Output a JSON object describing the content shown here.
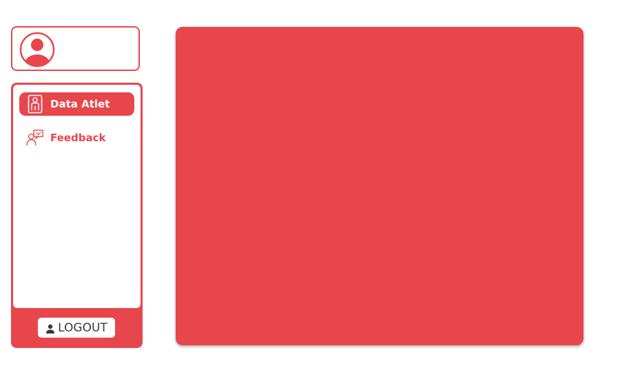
{
  "profile": {
    "avatar_icon": "user-circle-icon"
  },
  "sidebar": {
    "items": [
      {
        "label": "Data Atlet",
        "icon": "athlete-card-icon",
        "active": true
      },
      {
        "label": "Feedback",
        "icon": "user-feedback-icon",
        "active": false
      }
    ],
    "logout_label": "LOGOUT",
    "logout_icon": "person-icon"
  },
  "theme": {
    "accent": "#e8464d",
    "background": "#ffffff"
  }
}
